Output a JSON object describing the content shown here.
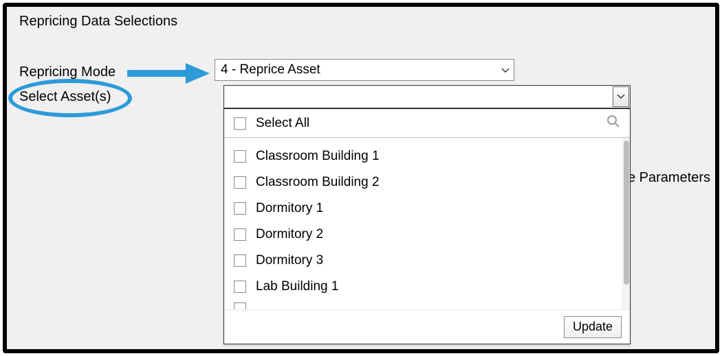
{
  "panel": {
    "title": "Repricing Data Selections",
    "labels": {
      "mode": "Repricing Mode",
      "assets": "Select Asset(s)"
    }
  },
  "mode_select": {
    "value": "4 - Reprice Asset"
  },
  "asset_select": {
    "value": ""
  },
  "dropdown": {
    "selectAllLabel": "Select All",
    "items": [
      {
        "label": "Classroom Building 1"
      },
      {
        "label": "Classroom Building 2"
      },
      {
        "label": "Dormitory 1"
      },
      {
        "label": "Dormitory 2"
      },
      {
        "label": "Dormitory 3"
      },
      {
        "label": "Lab Building 1"
      }
    ],
    "updateLabel": "Update"
  },
  "background_text": {
    "parameters_partial": "e Parameters"
  }
}
